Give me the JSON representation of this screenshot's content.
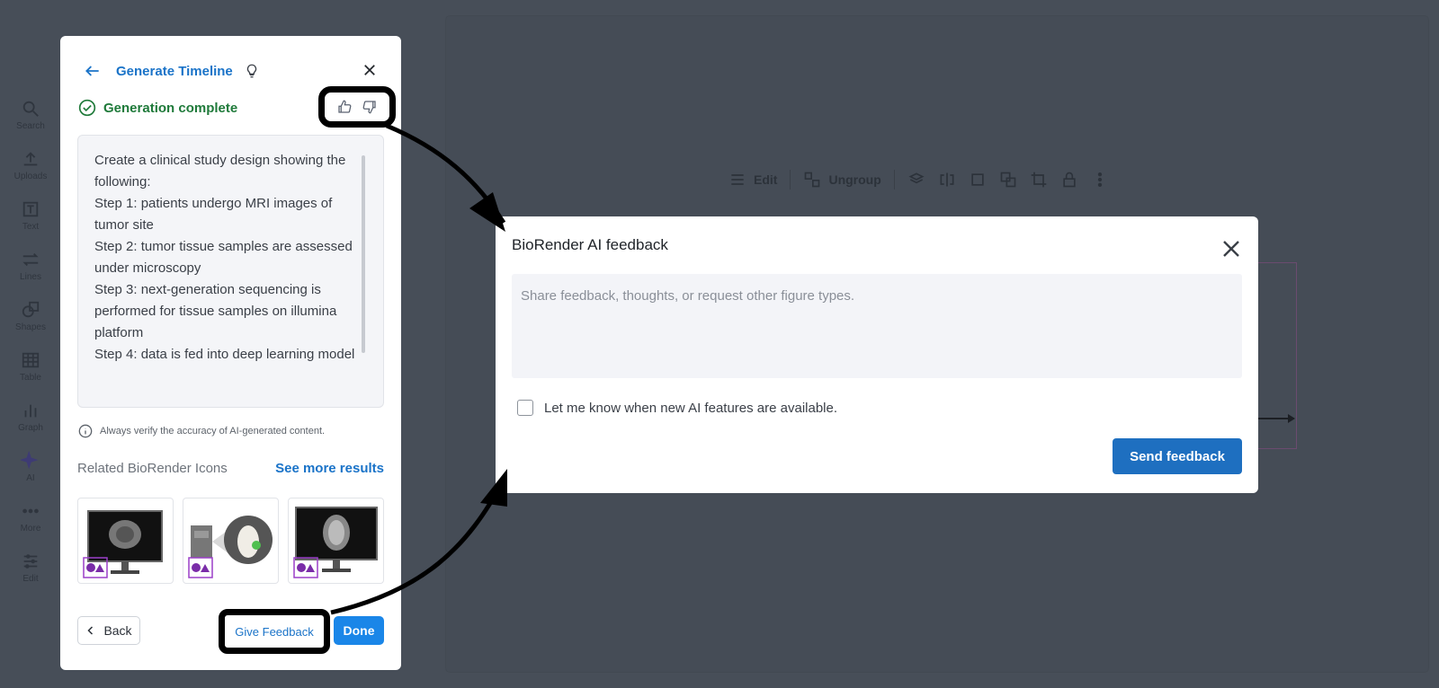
{
  "rail": {
    "items": [
      {
        "label": "Search",
        "icon": "search-icon"
      },
      {
        "label": "Uploads",
        "icon": "upload-icon"
      },
      {
        "label": "Text",
        "icon": "text-icon"
      },
      {
        "label": "Lines",
        "icon": "lines-icon"
      },
      {
        "label": "Shapes",
        "icon": "shapes-icon"
      },
      {
        "label": "Table",
        "icon": "table-icon"
      },
      {
        "label": "Graph",
        "icon": "graph-icon"
      },
      {
        "label": "AI",
        "icon": "sparkle-icon"
      },
      {
        "label": "More",
        "icon": "more-icon"
      },
      {
        "label": "Edit",
        "icon": "sliders-icon"
      }
    ]
  },
  "toolbar": {
    "edit_label": "Edit",
    "ungroup_label": "Ungroup"
  },
  "panel": {
    "title": "Generate Timeline",
    "status": "Generation complete",
    "prompt": "Create a clinical study design showing the following:\nStep 1: patients undergo MRI images of tumor site\nStep 2: tumor tissue samples are assessed under microscopy\nStep 3: next-generation sequencing is performed for tissue samples on illumina platform\nStep 4: data is fed into deep learning model",
    "verify_note": "Always verify the accuracy of AI-generated content.",
    "related_label": "Related BioRender Icons",
    "see_more_label": "See more results",
    "back_label": "Back",
    "feedback_label": "Give Feedback",
    "done_label": "Done"
  },
  "dialog": {
    "title": "BioRender AI feedback",
    "placeholder": "Share feedback, thoughts, or request other figure types.",
    "checkbox_label": "Let me know when new AI features are available.",
    "send_label": "Send feedback"
  },
  "colors": {
    "accent": "#1a73c8",
    "success": "#1f7a3a",
    "primary_button": "#1e6fc0",
    "done_button": "#1a86e8",
    "backdrop": "#474e58"
  }
}
